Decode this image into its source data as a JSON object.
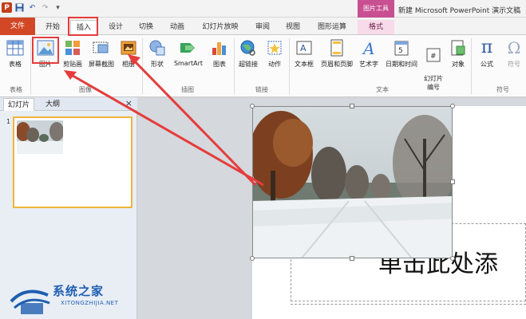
{
  "window": {
    "title": "新建 Microsoft PowerPoint 演示文稿",
    "context_tools_label": "图片工具"
  },
  "tabs": [
    "文件",
    "开始",
    "插入",
    "设计",
    "切换",
    "动画",
    "幻灯片放映",
    "审阅",
    "视图",
    "图形运算",
    "格式"
  ],
  "ribbon": {
    "buttons": {
      "table": "表格",
      "picture": "图片",
      "clipart": "剪贴画",
      "screenshot": "屏幕截图",
      "album": "相册",
      "shapes": "形状",
      "smartart": "SmartArt",
      "chart": "图表",
      "hyperlink": "超链接",
      "action": "动作",
      "textbox": "文本框",
      "header_footer": "页眉和页脚",
      "wordart": "艺术字",
      "datetime": "日期和时间",
      "slide_number": "幻灯片\n编号",
      "object": "对象",
      "formula": "公式",
      "symbol": "符号"
    },
    "groups": {
      "tables": "表格",
      "images": "图像",
      "illustrations": "插图",
      "links": "链接",
      "text": "文本",
      "symbols": "符号"
    }
  },
  "left_pane": {
    "tab_slides": "幻灯片",
    "tab_outline": "大纲",
    "close": "×",
    "slide_number": "1"
  },
  "slide": {
    "placeholder_text": "单击此处添"
  },
  "watermark": {
    "name": "系统之家",
    "url": "XITONGZHIJIA.NET"
  },
  "colors": {
    "file_tab": "#d24726",
    "context_tab": "#c84f91",
    "highlight": "#e53c3c"
  }
}
